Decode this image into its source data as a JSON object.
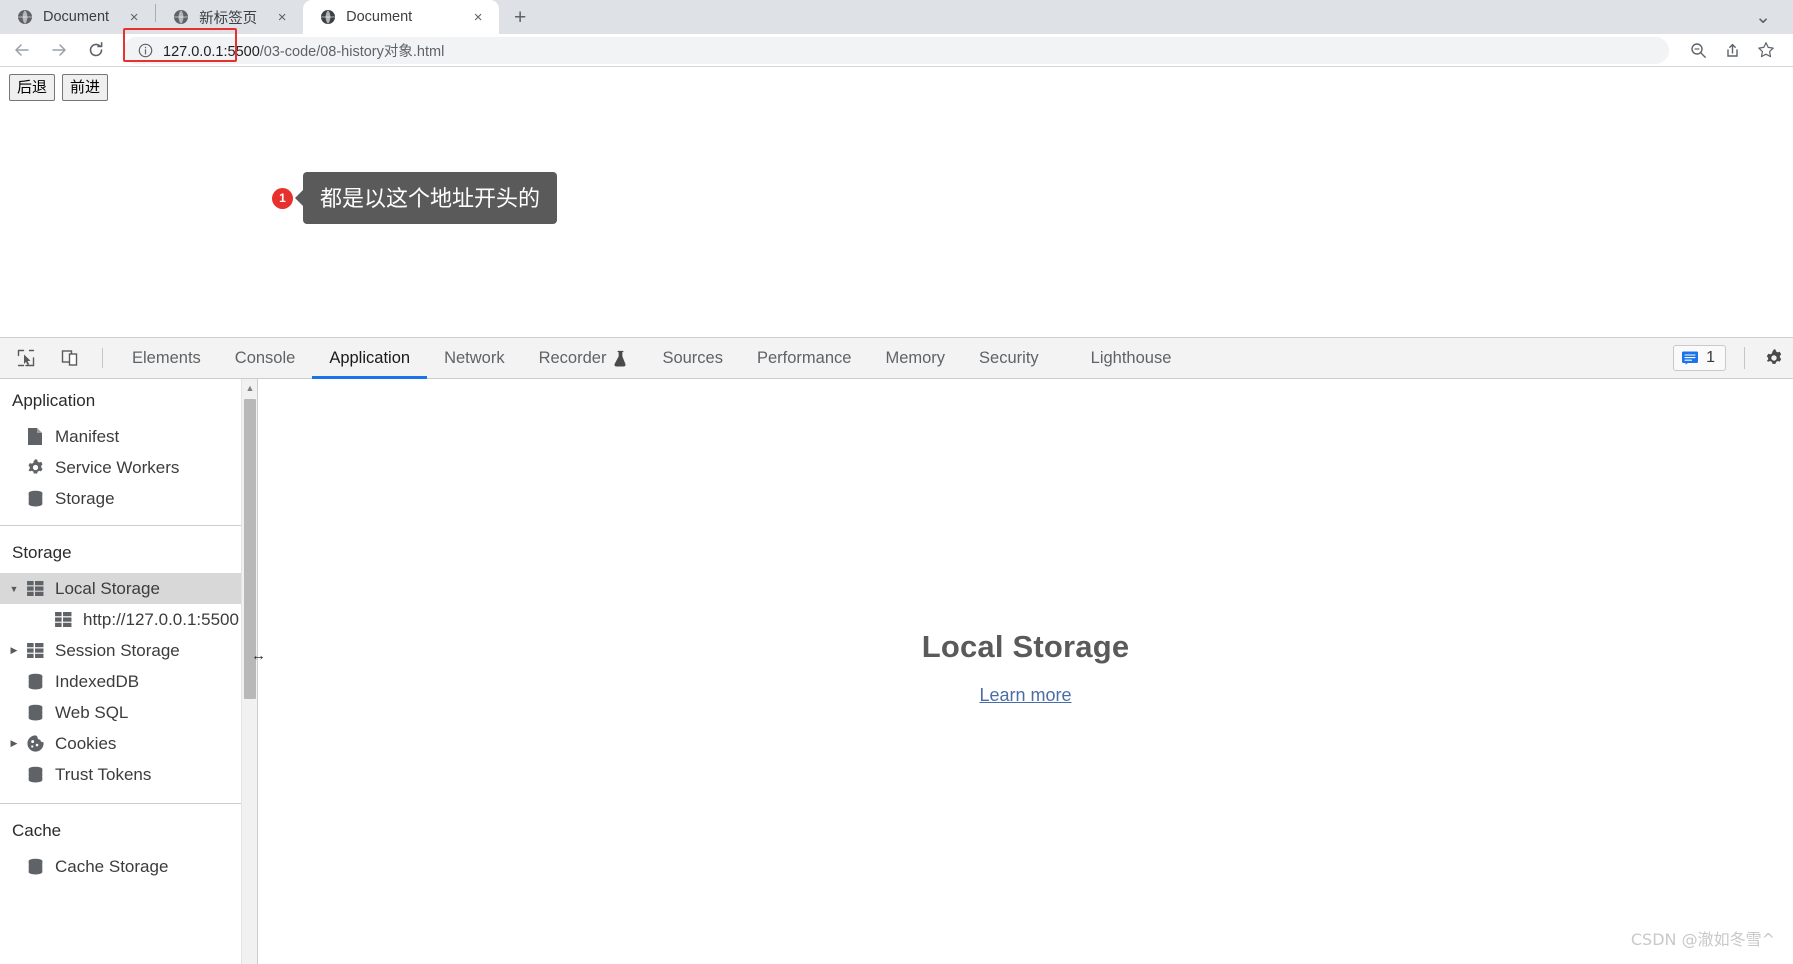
{
  "browser": {
    "tabs": [
      {
        "title": "Document",
        "icon": "globe-icon",
        "active": false,
        "close": "×"
      },
      {
        "title": "新标签页",
        "icon": "globe-icon",
        "active": false,
        "close": "×"
      },
      {
        "title": "Document",
        "icon": "globe-icon",
        "active": true,
        "close": "×"
      }
    ],
    "new_tab_label": "+",
    "window_menu_label": "⌄",
    "toolbar": {
      "back_label": "←",
      "forward_label": "→",
      "reload_label": "↻",
      "info_label": "ⓘ",
      "url_host": "127.0.0.1:5500",
      "url_path": "/03-code/08-history对象.html",
      "zoom_label": "⊕",
      "share_label": "⇧",
      "bookmark_label": "☆"
    }
  },
  "page": {
    "buttons": [
      {
        "label": "后退"
      },
      {
        "label": "前进"
      }
    ],
    "annotation": {
      "badge": "1",
      "text": "都是以这个地址开头的"
    }
  },
  "devtools": {
    "toolbar_icons": [
      {
        "name": "inspect-element-icon"
      },
      {
        "name": "device-toolbar-icon"
      }
    ],
    "tabs": [
      {
        "label": "Elements",
        "active": false,
        "icon": null
      },
      {
        "label": "Console",
        "active": false,
        "icon": null
      },
      {
        "label": "Application",
        "active": true,
        "icon": null
      },
      {
        "label": "Network",
        "active": false,
        "icon": null
      },
      {
        "label": "Recorder",
        "active": false,
        "icon": "flask-icon"
      },
      {
        "label": "Sources",
        "active": false,
        "icon": null
      },
      {
        "label": "Performance",
        "active": false,
        "icon": null
      },
      {
        "label": "Memory",
        "active": false,
        "icon": null
      },
      {
        "label": "Security",
        "active": false,
        "icon": null
      },
      {
        "label": "Lighthouse",
        "active": false,
        "icon": null
      }
    ],
    "console_badge": {
      "icon": "message-icon",
      "count": "1"
    },
    "settings_icon": "gear-icon",
    "sidebar": {
      "application_section": {
        "title": "Application",
        "items": [
          {
            "label": "Manifest",
            "icon": "document-icon",
            "arrow": null,
            "selected": false,
            "indent": 0
          },
          {
            "label": "Service Workers",
            "icon": "gear-icon",
            "arrow": null,
            "selected": false,
            "indent": 0
          },
          {
            "label": "Storage",
            "icon": "database-icon",
            "arrow": null,
            "selected": false,
            "indent": 0
          }
        ]
      },
      "storage_section": {
        "title": "Storage",
        "items": [
          {
            "label": "Local Storage",
            "icon": "table-icon",
            "arrow": "▼",
            "selected": true,
            "indent": 0
          },
          {
            "label": "http://127.0.0.1:5500",
            "icon": "table-icon",
            "arrow": null,
            "selected": false,
            "indent": 1
          },
          {
            "label": "Session Storage",
            "icon": "table-icon",
            "arrow": "▶",
            "selected": false,
            "indent": 0
          },
          {
            "label": "IndexedDB",
            "icon": "database-icon",
            "arrow": null,
            "selected": false,
            "indent": 0
          },
          {
            "label": "Web SQL",
            "icon": "database-icon",
            "arrow": null,
            "selected": false,
            "indent": 0
          },
          {
            "label": "Cookies",
            "icon": "cookie-icon",
            "arrow": "▶",
            "selected": false,
            "indent": 0
          },
          {
            "label": "Trust Tokens",
            "icon": "database-icon",
            "arrow": null,
            "selected": false,
            "indent": 0
          }
        ]
      },
      "cache_section": {
        "title": "Cache",
        "items": [
          {
            "label": "Cache Storage",
            "icon": "database-icon",
            "arrow": null,
            "selected": false,
            "indent": 0
          }
        ]
      },
      "resize_handle": "↔"
    },
    "main_panel": {
      "title": "Local Storage",
      "link": "Learn more"
    }
  },
  "watermark": "CSDN @澈如冬雪^",
  "colors": {
    "accent": "#1a73e8",
    "annotation_badge": "#e8312c",
    "annotation_bubble": "#5a5a5a",
    "url_highlight": "#e8302f",
    "link": "#4a6da7"
  }
}
